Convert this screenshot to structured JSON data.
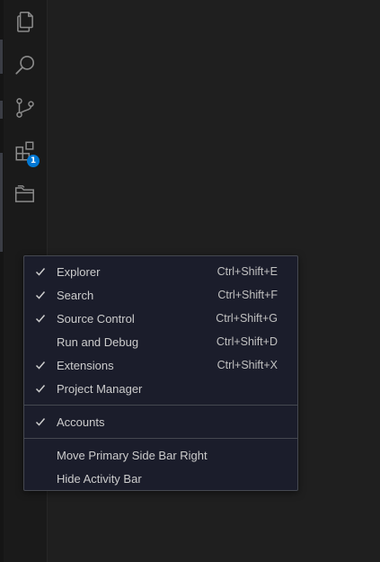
{
  "colors": {
    "background": "#1f1f1f",
    "activity_bar": "#1a1a1a",
    "menu_background": "#1b1d2b",
    "menu_border": "#454850",
    "menu_text": "#cccccc",
    "badge": "#0078d4",
    "icon": "#8b8b8b"
  },
  "activity_bar": {
    "items": [
      {
        "icon": "files-icon",
        "name": "Explorer"
      },
      {
        "icon": "search-icon",
        "name": "Search"
      },
      {
        "icon": "source-control-icon",
        "name": "Source Control"
      },
      {
        "icon": "extensions-icon",
        "name": "Extensions",
        "badge": "1"
      },
      {
        "icon": "folder-icon",
        "name": "Project Manager"
      }
    ]
  },
  "context_menu": {
    "group1": [
      {
        "label": "Explorer",
        "shortcut": "Ctrl+Shift+E",
        "checked": true
      },
      {
        "label": "Search",
        "shortcut": "Ctrl+Shift+F",
        "checked": true
      },
      {
        "label": "Source Control",
        "shortcut": "Ctrl+Shift+G",
        "checked": true
      },
      {
        "label": "Run and Debug",
        "shortcut": "Ctrl+Shift+D",
        "checked": false
      },
      {
        "label": "Extensions",
        "shortcut": "Ctrl+Shift+X",
        "checked": true
      },
      {
        "label": "Project Manager",
        "shortcut": "",
        "checked": true
      }
    ],
    "group2": [
      {
        "label": "Accounts",
        "shortcut": "",
        "checked": true
      }
    ],
    "group3": [
      {
        "label": "Move Primary Side Bar Right",
        "shortcut": "",
        "checked": false
      },
      {
        "label": "Hide Activity Bar",
        "shortcut": "",
        "checked": false
      }
    ]
  }
}
